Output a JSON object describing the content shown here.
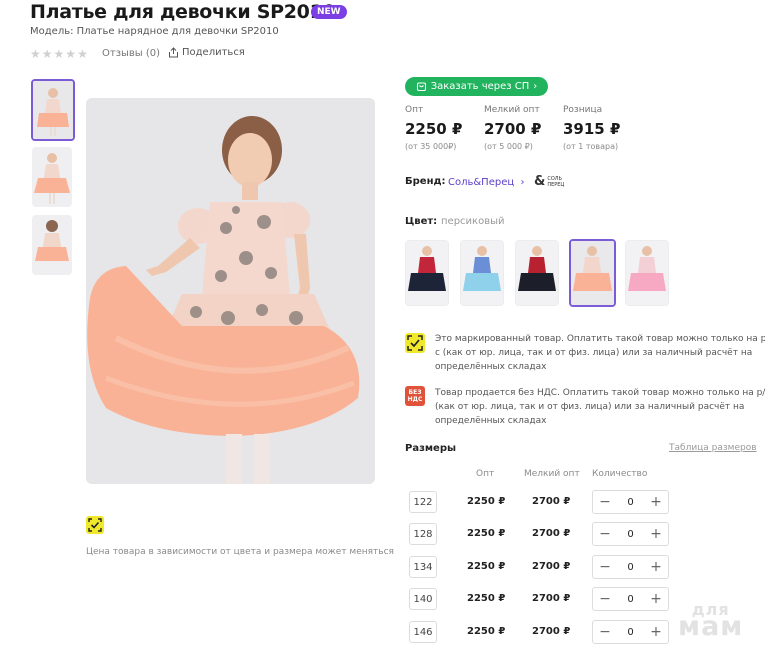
{
  "product": {
    "title": "Платье для девочки SP2010",
    "badge": "NEW",
    "model": "Модель: Платье нарядное для девочки SP2010",
    "reviews": "Отзывы (0)",
    "rating": 0,
    "share": "Поделиться"
  },
  "order_button": "Заказать через СП",
  "prices": [
    {
      "label": "Опт",
      "value": "2250 ₽",
      "note": "(от 35 000₽)"
    },
    {
      "label": "Мелкий опт",
      "value": "2700 ₽",
      "note": "(от 5 000 ₽)"
    },
    {
      "label": "Розница",
      "value": "3915 ₽",
      "note": "(от 1 товара)"
    }
  ],
  "brand": {
    "label": "Бренд:",
    "name": "Соль&Перец",
    "logo": "СОЛЬ ПЕРЕЦ"
  },
  "color": {
    "label": "Цвет:",
    "value": "персиковый"
  },
  "notices": [
    {
      "icon": "honest-sign-icon",
      "text": "Это маркированный товар. Оплатить такой товар можно только на р/с (как от юр. лица, так и от физ. лица) или за наличный расчёт на определённых складах"
    },
    {
      "icon": "no-vat-icon",
      "icon_text": "БЕЗ НДС",
      "text": "Товар продается без НДС. Оплатить такой товар можно только на р/с (как от юр. лица, так и от физ. лица) или за наличный расчёт на определённых складах"
    }
  ],
  "price_note": "Цена товара в зависимости от цвета и размера может меняться",
  "sizes": {
    "title": "Размеры",
    "table_link": "Таблица размеров",
    "columns": [
      "Опт",
      "Мелкий опт",
      "Количество"
    ],
    "rows": [
      {
        "size": "122",
        "opt": "2250 ₽",
        "small_opt": "2700 ₽",
        "qty": "0"
      },
      {
        "size": "128",
        "opt": "2250 ₽",
        "small_opt": "2700 ₽",
        "qty": "0"
      },
      {
        "size": "134",
        "opt": "2250 ₽",
        "small_opt": "2700 ₽",
        "qty": "0"
      },
      {
        "size": "140",
        "opt": "2250 ₽",
        "small_opt": "2700 ₽",
        "qty": "0"
      },
      {
        "size": "146",
        "opt": "2250 ₽",
        "small_opt": "2700 ₽",
        "qty": "0"
      }
    ]
  },
  "watermark": {
    "top": "для",
    "bottom": "мам"
  },
  "colors": {
    "accent": "#7b5cd6",
    "order_green": "#22b35e",
    "honest_yellow": "#f0e82a",
    "novat_red": "#e0533b",
    "skirt_peach": "#f9b296"
  }
}
